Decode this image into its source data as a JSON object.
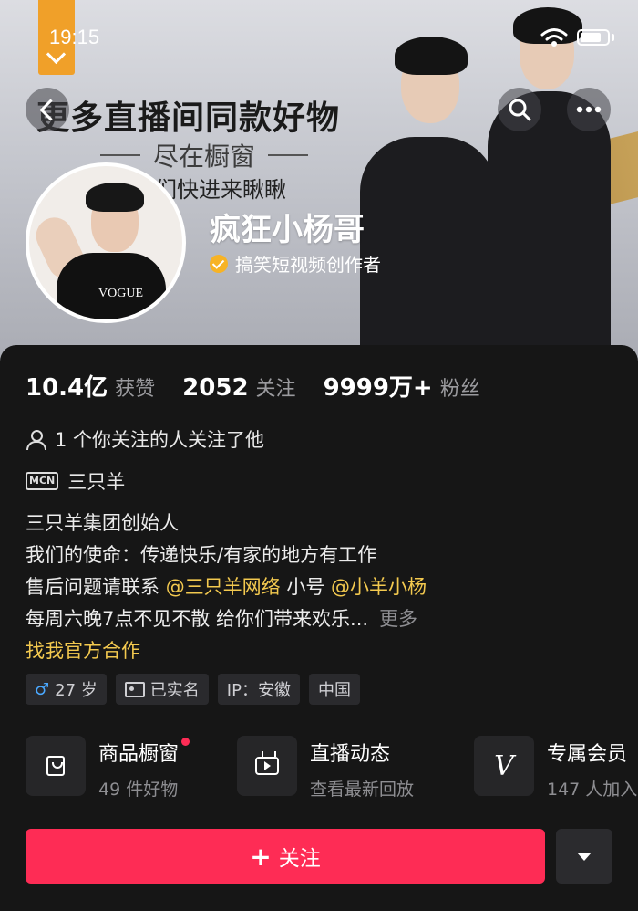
{
  "status_bar": {
    "time": "19:15"
  },
  "banner": {
    "title": "更多直播间同款好物",
    "subtitle": "尽在橱窗",
    "subtitle2": "们快进来瞅瞅"
  },
  "profile": {
    "name": "疯狂小杨哥",
    "verification": "搞笑短视频创作者",
    "avatar_logo": "VOGUE"
  },
  "stats": [
    {
      "value": "10.4亿",
      "label": "获赞"
    },
    {
      "value": "2052",
      "label": "关注"
    },
    {
      "value": "9999万+",
      "label": "粉丝"
    }
  ],
  "mutual": "1 个你关注的人关注了他",
  "mcn": {
    "badge": "MCN",
    "name": "三只羊"
  },
  "bio": {
    "line1": "三只羊集团创始人",
    "line2": "我们的使命：传递快乐/有家的地方有工作",
    "line3_prefix": "售后问题请联系 ",
    "line3_mention1": "@三只羊网络",
    "line3_mid": " 小号 ",
    "line3_mention2": "@小羊小杨",
    "line4": "每周六晚7点不见不散  给你们带来欢乐...",
    "more": "更多",
    "cooperation": "找我官方合作"
  },
  "tags": {
    "age": "27 岁",
    "verified": "已实名",
    "ip": "IP：安徽",
    "country": "中国"
  },
  "features": [
    {
      "title": "商品橱窗",
      "subtitle": "49 件好物",
      "icon": "shopping-bag-icon"
    },
    {
      "title": "直播动态",
      "subtitle": "查看最新回放",
      "icon": "live-tv-icon"
    },
    {
      "title": "专属会员",
      "subtitle": "147 人加入",
      "icon": "vip-icon"
    }
  ],
  "actions": {
    "follow": "关注",
    "follow_prefix": "+"
  },
  "colors": {
    "accent": "#fe2c55",
    "mention": "#f3c94f",
    "verify_badge": "#f7b325",
    "tag_bg": "#2a2a2d"
  }
}
